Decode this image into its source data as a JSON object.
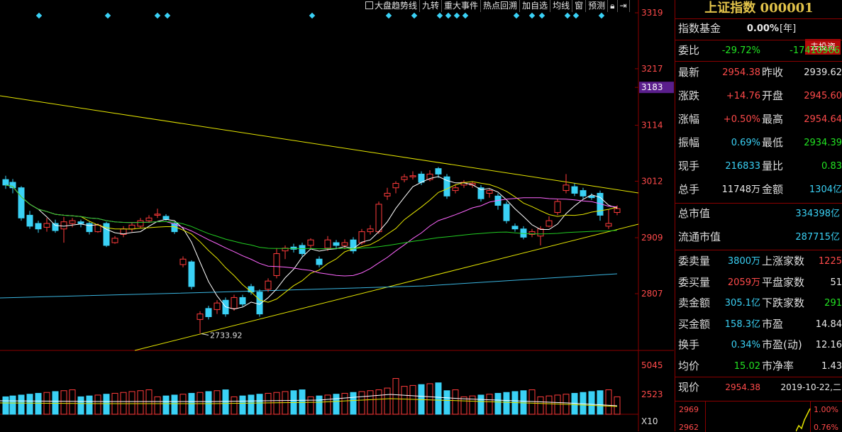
{
  "toolbar": {
    "items": [
      "大盘趋势线",
      "九转",
      "重大事件",
      "热点回溯",
      "加自选",
      "均线",
      "窗",
      "预测"
    ],
    "lock_icon": "lock-icon",
    "collapse_icon": "collapse-right-icon"
  },
  "price_axis": [
    "3319",
    "3217",
    "3183",
    "3114",
    "3012",
    "2909",
    "2807"
  ],
  "volume_axis": [
    "5045",
    "2523",
    "X10"
  ],
  "low_annotation": "2733.92",
  "chart_data": {
    "type": "candlestick",
    "y_range_price": [
      2733,
      3319
    ],
    "highlight_price": 3183,
    "annotated_low": 2733.92,
    "volume_ticks": [
      5045,
      2523
    ],
    "volume_unit": "X10"
  },
  "panel": {
    "title": "上证指数 000001",
    "fund_label": "指数基金",
    "fund_value": "0.00%",
    "fund_unit": "[年]",
    "invest_btn": "去投资",
    "weibi_label": "委比",
    "weibi_pct": "-29.72%",
    "weibi_val": "-17410966",
    "rows": [
      {
        "l1": "最新",
        "v1": "2954.38",
        "c1": "red",
        "l2": "昨收",
        "v2": "2939.62",
        "c2": "white"
      },
      {
        "l1": "涨跌",
        "v1": "+14.76",
        "c1": "red",
        "l2": "开盘",
        "v2": "2945.60",
        "c2": "red"
      },
      {
        "l1": "涨幅",
        "v1": "+0.50%",
        "c1": "red",
        "l2": "最高",
        "v2": "2954.64",
        "c2": "red"
      },
      {
        "l1": "振幅",
        "v1": "0.69%",
        "c1": "cyan",
        "l2": "最低",
        "v2": "2934.39",
        "c2": "green"
      },
      {
        "l1": "现手",
        "v1": "216833",
        "c1": "cyan",
        "l2": "量比",
        "v2": "0.83",
        "c2": "green"
      },
      {
        "l1": "总手",
        "v1": "11748万",
        "c1": "white",
        "l2": "金额",
        "v2": "1304亿",
        "c2": "cyan"
      }
    ],
    "mkt_cap_label": "总市值",
    "mkt_cap": "334398亿",
    "float_cap_label": "流通市值",
    "float_cap": "287715亿",
    "rows2": [
      {
        "l1": "委卖量",
        "v1": "3800万",
        "c1": "cyan",
        "l2": "上涨家数",
        "v2": "1225",
        "c2": "red"
      },
      {
        "l1": "委买量",
        "v1": "2059万",
        "c1": "red",
        "l2": "平盘家数",
        "v2": "51",
        "c2": "white"
      },
      {
        "l1": "卖金额",
        "v1": "305.1亿",
        "c1": "cyan",
        "l2": "下跌家数",
        "v2": "291",
        "c2": "green"
      },
      {
        "l1": "买金额",
        "v1": "158.3亿",
        "c1": "cyan",
        "l2": "市盈",
        "v2": "14.84",
        "c2": "white"
      },
      {
        "l1": "换手",
        "v1": "0.34%",
        "c1": "cyan",
        "l2": "市盈(动)",
        "v2": "12.16",
        "c2": "white"
      },
      {
        "l1": "均价",
        "v1": "15.02",
        "c1": "green",
        "l2": "市净率",
        "v2": "1.43",
        "c2": "white"
      }
    ],
    "now_label": "现价",
    "now_price": "2954.38",
    "date": "2019-10-22,二",
    "mini_y1": "2969",
    "mini_y2": "2962",
    "mini_p1": "1.00%",
    "mini_p2": "0.76%"
  }
}
